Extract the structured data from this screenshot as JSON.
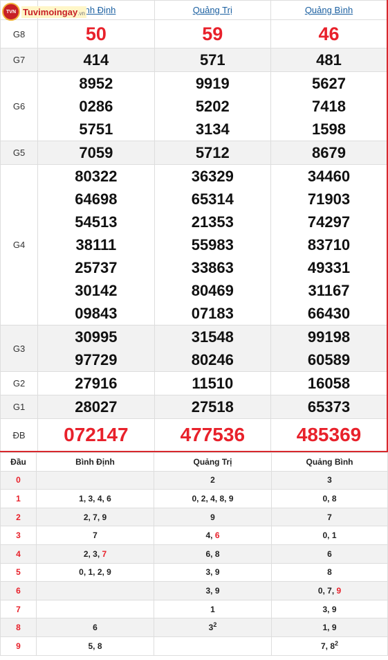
{
  "logo": {
    "text": "Tuvimoingay",
    "suffix": ".vn"
  },
  "provinces": [
    "Bình Định",
    "Quảng Trị",
    "Quảng Bình"
  ],
  "prizes": [
    {
      "label": "G8",
      "values": [
        [
          "50"
        ],
        [
          "59"
        ],
        [
          "46"
        ]
      ]
    },
    {
      "label": "G7",
      "values": [
        [
          "414"
        ],
        [
          "571"
        ],
        [
          "481"
        ]
      ]
    },
    {
      "label": "G6",
      "values": [
        [
          "8952",
          "0286",
          "5751"
        ],
        [
          "9919",
          "5202",
          "3134"
        ],
        [
          "5627",
          "7418",
          "1598"
        ]
      ]
    },
    {
      "label": "G5",
      "values": [
        [
          "7059"
        ],
        [
          "5712"
        ],
        [
          "8679"
        ]
      ]
    },
    {
      "label": "G4",
      "values": [
        [
          "80322",
          "64698",
          "54513",
          "38111",
          "25737",
          "30142",
          "09843"
        ],
        [
          "36329",
          "65314",
          "21353",
          "55983",
          "33863",
          "80469",
          "07183"
        ],
        [
          "34460",
          "71903",
          "74297",
          "83710",
          "49331",
          "31167",
          "66430"
        ]
      ]
    },
    {
      "label": "G3",
      "values": [
        [
          "30995",
          "97729"
        ],
        [
          "31548",
          "80246"
        ],
        [
          "99198",
          "60589"
        ]
      ]
    },
    {
      "label": "G2",
      "values": [
        [
          "27916"
        ],
        [
          "11510"
        ],
        [
          "16058"
        ]
      ]
    },
    {
      "label": "G1",
      "values": [
        [
          "28027"
        ],
        [
          "27518"
        ],
        [
          "65373"
        ]
      ]
    },
    {
      "label": "ĐB",
      "values": [
        [
          "072147"
        ],
        [
          "477536"
        ],
        [
          "485369"
        ]
      ]
    }
  ],
  "loto": {
    "header": "Đầu",
    "rows": [
      {
        "head": "0",
        "cells": [
          "",
          "2",
          "3"
        ]
      },
      {
        "head": "1",
        "cells": [
          "1, 3, 4, 6",
          "0, 2, 4, 8, 9",
          "0, 8"
        ]
      },
      {
        "head": "2",
        "cells": [
          "2, 7, 9",
          "9",
          "7"
        ]
      },
      {
        "head": "3",
        "cells": [
          "7",
          "4, <span class=\"hl\">6</span>",
          "0, 1"
        ]
      },
      {
        "head": "4",
        "cells": [
          "2, 3, <span class=\"hl\">7</span>",
          "6, 8",
          "6"
        ]
      },
      {
        "head": "5",
        "cells": [
          "0, 1, 2, 9",
          "3, 9",
          "8"
        ]
      },
      {
        "head": "6",
        "cells": [
          "",
          "3, 9",
          "0, 7, <span class=\"hl\">9</span>"
        ]
      },
      {
        "head": "7",
        "cells": [
          "",
          "1",
          "3, 9"
        ]
      },
      {
        "head": "8",
        "cells": [
          "6",
          "3<sup>2</sup>",
          "1, 9"
        ]
      },
      {
        "head": "9",
        "cells": [
          "5, 8",
          "",
          "7, 8<sup>2</sup>"
        ]
      }
    ]
  },
  "colors": {
    "accent_red": "#e8212b",
    "link_blue": "#1a5fa0",
    "row_alt": "#f2f2f2"
  }
}
